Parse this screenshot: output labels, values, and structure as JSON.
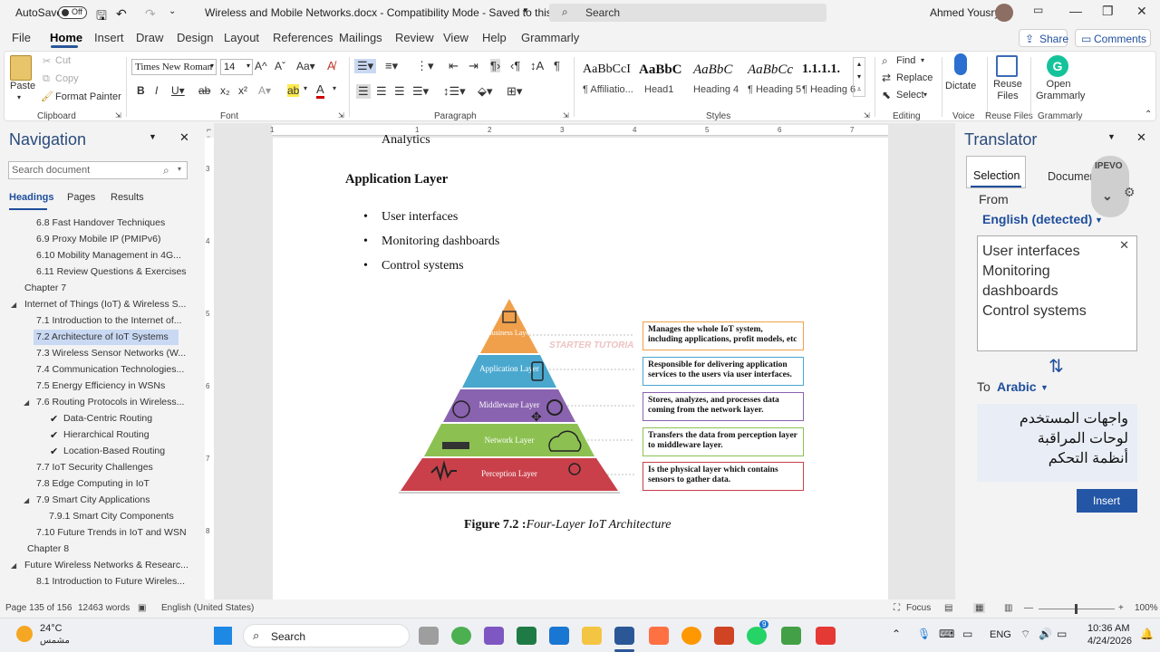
{
  "titlebar": {
    "autosave": "AutoSave",
    "autosave_state": "Off",
    "doc_title": "Wireless and Mobile Networks.docx  -  Compatibility Mode  -  Saved to this PC",
    "search": "Search",
    "user": "Ahmed Yousry"
  },
  "menu": {
    "items": [
      "File",
      "Home",
      "Insert",
      "Draw",
      "Design",
      "Layout",
      "References",
      "Mailings",
      "Review",
      "View",
      "Help",
      "Grammarly"
    ],
    "share": "Share",
    "comments": "Comments"
  },
  "ribbon": {
    "clipboard": {
      "paste": "Paste",
      "cut": "Cut",
      "copy": "Copy",
      "format_painter": "Format Painter",
      "label": "Clipboard"
    },
    "font": {
      "name": "Times New Roman",
      "size": "14",
      "label": "Font"
    },
    "paragraph": {
      "label": "Paragraph"
    },
    "styles": {
      "label": "Styles",
      "items": [
        {
          "preview": "AaBbCcI",
          "name": "¶ Affiliatio..."
        },
        {
          "preview": "AaBbC",
          "name": "Head1"
        },
        {
          "preview": "AaBbC",
          "name": "Heading 4"
        },
        {
          "preview": "AaBbCc",
          "name": "¶ Heading 5"
        },
        {
          "preview": "1.1.1.1.",
          "name": "¶ Heading 6"
        }
      ]
    },
    "editing": {
      "find": "Find",
      "replace": "Replace",
      "select": "Select",
      "label": "Editing"
    },
    "voice": {
      "dictate": "Dictate",
      "label": "Voice"
    },
    "reuse": {
      "button": "Reuse Files",
      "label": "Reuse Files"
    },
    "grammarly": {
      "button": "Open Grammarly",
      "label": "Grammarly"
    }
  },
  "navigation": {
    "title": "Navigation",
    "search_placeholder": "Search document",
    "tabs": [
      "Headings",
      "Pages",
      "Results"
    ],
    "items": [
      {
        "label": "6.8 Fast Handover Techniques",
        "level": 2
      },
      {
        "label": "6.9 Proxy Mobile IP (PMIPv6)",
        "level": 2
      },
      {
        "label": "6.10 Mobility Management in 4G...",
        "level": 2
      },
      {
        "label": "6.11 Review Questions & Exercises",
        "level": 2
      },
      {
        "label": "Chapter 7",
        "level": 1
      },
      {
        "label": "Internet of Things (IoT) & Wireless S...",
        "level": 1
      },
      {
        "label": "7.1 Introduction to the Internet of...",
        "level": 2
      },
      {
        "label": "7.2 Architecture of IoT Systems",
        "level": 2
      },
      {
        "label": "7.3 Wireless Sensor Networks (W...",
        "level": 2
      },
      {
        "label": "7.4 Communication Technologies...",
        "level": 2
      },
      {
        "label": "7.5 Energy Efficiency in WSNs",
        "level": 2
      },
      {
        "label": "7.6 Routing Protocols in Wireless...",
        "level": 2
      },
      {
        "label": "Data-Centric Routing",
        "level": 3
      },
      {
        "label": "Hierarchical Routing",
        "level": 3
      },
      {
        "label": "Location-Based Routing",
        "level": 3
      },
      {
        "label": "7.7 IoT Security Challenges",
        "level": 2
      },
      {
        "label": "7.8 Edge Computing in IoT",
        "level": 2
      },
      {
        "label": "7.9 Smart City Applications",
        "level": 2
      },
      {
        "label": "7.9.1 Smart City Components",
        "level": 3
      },
      {
        "label": "7.10 Future Trends in IoT and WSN",
        "level": 2
      },
      {
        "label": "Chapter 8",
        "level": 1
      },
      {
        "label": "Future Wireless Networks & Researc...",
        "level": 1
      },
      {
        "label": "8.1 Introduction to Future Wireles...",
        "level": 2
      }
    ]
  },
  "document": {
    "top_bullet": "Analytics",
    "heading": "Application Layer",
    "bullets": [
      "User interfaces",
      "Monitoring dashboards",
      "Control systems"
    ],
    "pyramid": {
      "layers": [
        "Business Layer",
        "Application Layer",
        "Middleware Layer",
        "Network Layer",
        "Perception Layer"
      ],
      "descriptions": [
        "Manages the whole IoT system, including applications, profit models, etc",
        "Responsible for delivering application services to the users via user interfaces.",
        "Stores, analyzes, and processes data coming from the network layer.",
        "Transfers the data from perception layer to middleware layer.",
        "Is the physical layer which contains sensors to gather data."
      ],
      "colors": [
        "#f0a04b",
        "#4aa8cf",
        "#8a63b0",
        "#8cc152",
        "#c9404a"
      ],
      "watermark": "STARTER TUTORIALS"
    },
    "caption_bold": "Figure 7.2 :",
    "caption_italic": "Four-Layer IoT Architecture"
  },
  "translator": {
    "title": "Translator",
    "tab_selection": "Selection",
    "tab_document": "Document",
    "from": "From",
    "source_lang": "English (detected)",
    "source_text": "User interfaces\nMonitoring dashboards\nControl systems",
    "to": "To",
    "target_lang": "Arabic",
    "target_text": "واجهات المستخدم\nلوحات المراقبة\nأنظمة التحكم",
    "insert": "Insert",
    "ipevo": "IPEVO"
  },
  "status": {
    "page": "Page 135 of 156",
    "words": "12463 words",
    "language": "English (United States)",
    "focus": "Focus",
    "zoom": "100%"
  },
  "taskbar": {
    "temp": "24°C",
    "weather": "مشمس",
    "search": "Search",
    "lang": "ENG",
    "time": "10:36 AM",
    "date": "4/24/2026",
    "whatsapp_badge": "9"
  }
}
